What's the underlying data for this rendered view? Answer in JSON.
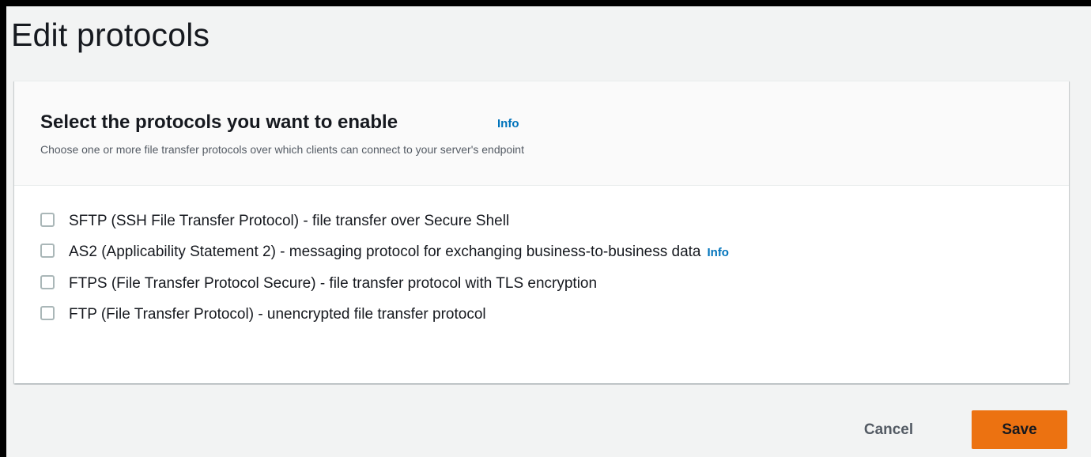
{
  "page": {
    "title": "Edit protocols"
  },
  "panel": {
    "title": "Select the protocols you want to enable",
    "info_label": "Info",
    "description": "Choose one or more file transfer protocols over which clients can connect to your server's endpoint"
  },
  "protocols": [
    {
      "label": "SFTP (SSH File Transfer Protocol) - file transfer over Secure Shell",
      "checked": false
    },
    {
      "label": "AS2 (Applicability Statement 2) - messaging protocol for exchanging business-to-business data",
      "info_label": "Info",
      "checked": false
    },
    {
      "label": "FTPS (File Transfer Protocol Secure) - file transfer protocol with TLS encryption",
      "checked": false
    },
    {
      "label": "FTP (File Transfer Protocol) - unencrypted file transfer protocol",
      "checked": false
    }
  ],
  "actions": {
    "cancel_label": "Cancel",
    "save_label": "Save"
  },
  "colors": {
    "primary_button": "#ec7211",
    "link": "#0073bb",
    "background": "#f2f3f3"
  }
}
